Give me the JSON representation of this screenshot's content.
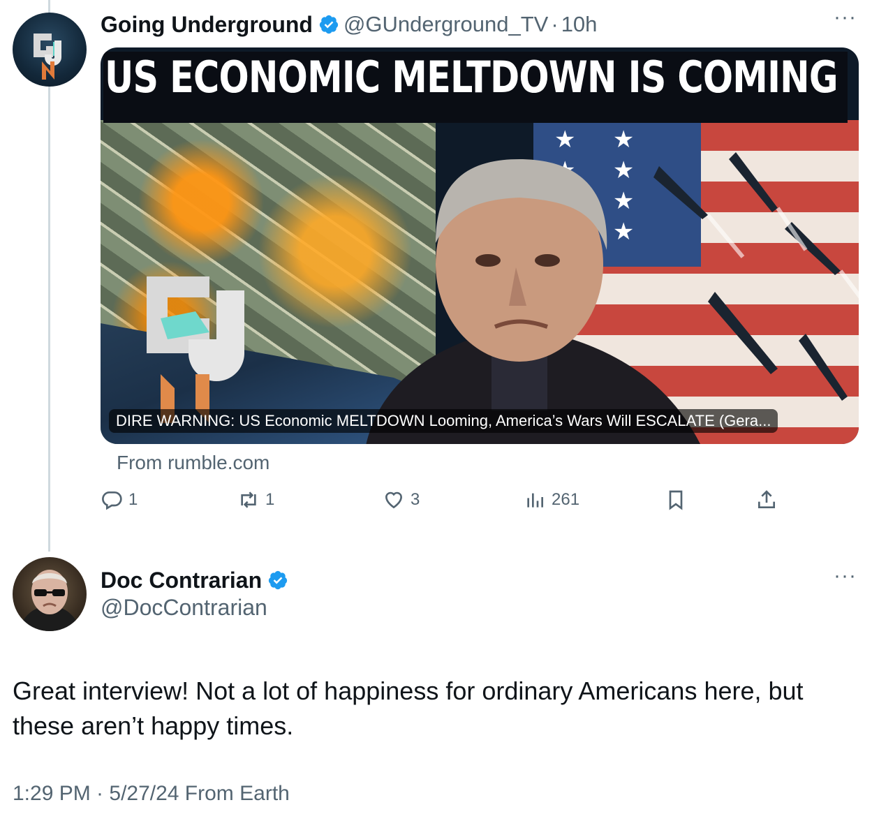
{
  "tweet1": {
    "display_name": "Going Underground",
    "handle": "@GUnderground_TV",
    "separator": "·",
    "time": "10h",
    "more": "···",
    "media": {
      "headline": "US ECONOMIC MELTDOWN IS COMING",
      "caption": "DIRE WARNING: US Economic MELTDOWN Looming, America’s Wars Will ESCALATE (Gera...",
      "source": "From rumble.com"
    },
    "actions": {
      "replies": "1",
      "reposts": "1",
      "likes": "3",
      "views": "261"
    }
  },
  "tweet2": {
    "display_name": "Doc Contrarian",
    "handle": "@DocContrarian",
    "more": "···",
    "text": "Great interview! Not a lot of happiness for ordinary Americans here, but these aren’t happy times.",
    "meta": "1:29 PM · 5/27/24 From Earth"
  },
  "colors": {
    "verified": "#1d9bf0",
    "secondary_text": "#536471",
    "primary_text": "#0f1419",
    "thread_line": "#cfd9de"
  },
  "icons": [
    "reply-icon",
    "repost-icon",
    "like-icon",
    "views-icon",
    "bookmark-icon",
    "share-icon",
    "verified-icon",
    "more-icon"
  ]
}
